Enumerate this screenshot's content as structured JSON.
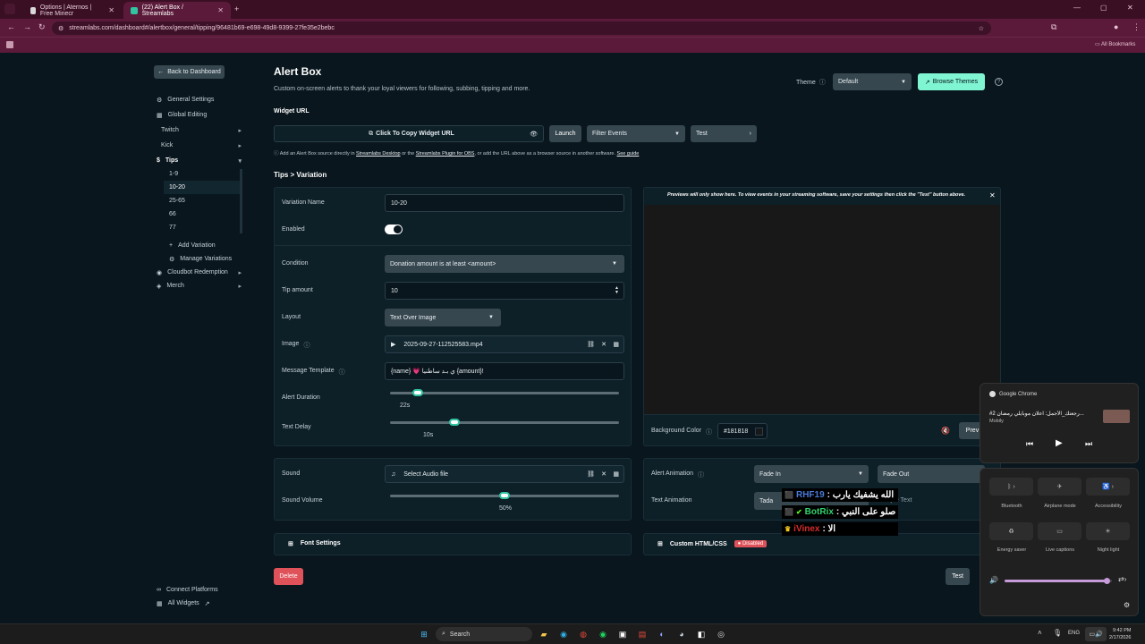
{
  "browser": {
    "tabs": [
      {
        "title": "Options | Aternos | Free Minecr"
      },
      {
        "title": "(22) Alert Box / Streamlabs"
      }
    ],
    "url": "streamlabs.com/dashboard#/alertbox/general/tipping/96481b69-e698-49d8-9399-27fe35e2bebc",
    "bookmarks_label": "All Bookmarks"
  },
  "sidebar": {
    "back": "Back to Dashboard",
    "general": "General Settings",
    "global": "Global Editing",
    "twitch": "Twitch",
    "kick": "Kick",
    "tips": "Tips",
    "variations": [
      "1-9",
      "10-20",
      "25-65",
      "66",
      "77"
    ],
    "add_variation": "Add Variation",
    "manage": "Manage Variations",
    "cloudbot": "Cloudbot Redemption",
    "merch": "Merch",
    "connect": "Connect Platforms",
    "all_widgets": "All Widgets"
  },
  "header": {
    "title": "Alert Box",
    "subtitle": "Custom on-screen alerts to thank your loyal viewers for following, subbing, tipping and more.",
    "theme_label": "Theme",
    "theme_value": "Default",
    "browse": "Browse Themes",
    "help": "?"
  },
  "widget": {
    "label": "Widget URL",
    "copy": "Click To Copy Widget URL",
    "launch": "Launch",
    "filter": "Filter Events",
    "test": "Test",
    "info_a": "Add an Alert Box source directly in",
    "link1": "Streamlabs Desktop",
    "info_b": "or the",
    "link2": "Streamlabs Plugin for OBS",
    "info_c": ", or add the URL above as a browser source in another software.",
    "link3": "See guide"
  },
  "breadcrumb": "Tips > Variation",
  "form": {
    "variation_name_label": "Variation Name",
    "variation_name": "10-20",
    "enabled_label": "Enabled",
    "condition_label": "Condition",
    "condition": "Donation amount is at least <amount>",
    "tip_label": "Tip amount",
    "tip": "10",
    "layout_label": "Layout",
    "layout": "Text Over Image",
    "image_label": "Image",
    "image": "2025-09-27-112525583.mp4",
    "message_label": "Message Template",
    "message": "{name} 💗 ي بـد ساطنيا {amount}!",
    "duration_label": "Alert Duration",
    "duration": "22s",
    "duration_fraction": 0.12,
    "delay_label": "Text Delay",
    "delay": "10s",
    "delay_fraction": 0.28,
    "sound_label": "Sound",
    "sound": "Select Audio file",
    "volume_label": "Sound Volume",
    "volume": "50%",
    "volume_fraction": 0.5,
    "font_settings": "Font Settings",
    "delete": "Delete"
  },
  "preview": {
    "notice": "Previews will only show here. To view events in your streaming software, save your settings then click the \"Test\" button above.",
    "bg_label": "Background Color",
    "bg_value": "#181818",
    "preview_btn": "Prev",
    "anim_label": "Alert Animation",
    "anim_in": "Fade In",
    "anim_out": "Fade Out",
    "text_anim_label": "Text Animation",
    "text_anim": "Tada",
    "sample": "Sample Text",
    "custom": "Custom HTML/CSS",
    "disabled": "Disabled",
    "test": "Test"
  },
  "chat": [
    {
      "user": "RHF19",
      "text": ": الله يشفيك يارب",
      "color": "#4a7ad9"
    },
    {
      "user": "BotRix",
      "text": ": صلو على النبي",
      "color": "#31d36b"
    },
    {
      "user": "iVinex",
      "text": ": الا",
      "color": "#d62b2b"
    }
  ],
  "media": {
    "app": "Google Chrome",
    "title": "#رجعتك_الأجمل: اعلان موبايلي رمضان 2...",
    "artist": "Mobily"
  },
  "quick": {
    "tiles": [
      "Bluetooth",
      "Airplane mode",
      "Accessibility",
      "Energy saver",
      "Live captions",
      "Night light"
    ],
    "volume_fraction": 0.95
  },
  "taskbar": {
    "search": "Search",
    "lang": "ENG",
    "time": "9:42 PM",
    "date": "2/17/2026"
  },
  "colors": {
    "accent": "#31c3a2",
    "danger": "#e0525a",
    "bg": "#09161d"
  }
}
